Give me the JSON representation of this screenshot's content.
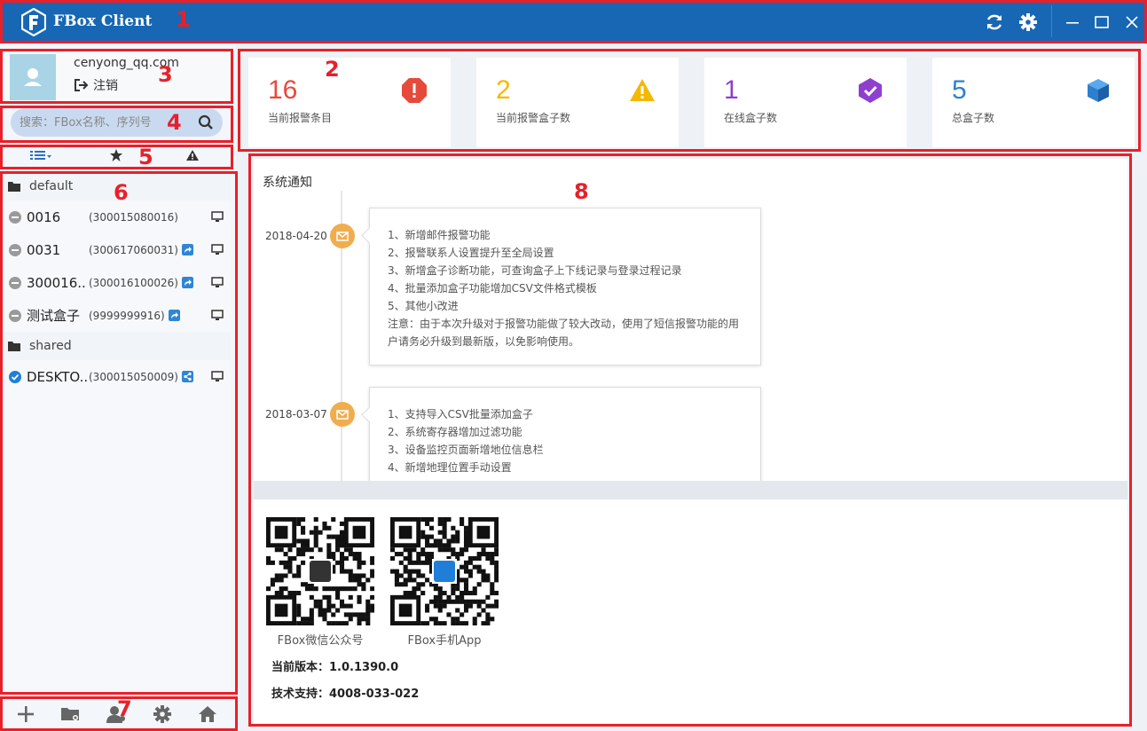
{
  "app": {
    "title": "FBox Client"
  },
  "user": {
    "email": "cenyong_qq.com",
    "logout_label": "注销"
  },
  "search": {
    "placeholder": "搜索：FBox名称、序列号"
  },
  "groups": [
    {
      "name": "default",
      "devices": [
        {
          "name": "0016",
          "serial": "(300015080016)",
          "status": "offline",
          "shared": false
        },
        {
          "name": "0031",
          "serial": "(300617060031)",
          "status": "offline",
          "shared": true
        },
        {
          "name": "300016..",
          "serial": "(300016100026)",
          "status": "offline",
          "shared": true
        },
        {
          "name": "测试盒子",
          "serial": "(9999999916)",
          "status": "offline",
          "shared": true
        }
      ]
    },
    {
      "name": "shared",
      "devices": [
        {
          "name": "DESKTO..",
          "serial": "(300015050009)",
          "status": "online",
          "shared": true
        }
      ]
    }
  ],
  "stats": [
    {
      "value": "16",
      "label": "当前报警条目",
      "color": "#e64a3b",
      "icon": "alarm-exclamation-icon"
    },
    {
      "value": "2",
      "label": "当前报警盒子数",
      "color": "#f5b800",
      "icon": "warning-triangle-icon"
    },
    {
      "value": "1",
      "label": "在线盒子数",
      "color": "#8e3fcf",
      "icon": "online-check-icon"
    },
    {
      "value": "5",
      "label": "总盒子数",
      "color": "#2d7fcf",
      "icon": "cube-icon"
    }
  ],
  "notice": {
    "title": "系统通知",
    "entries": [
      {
        "date": "2018-04-20",
        "lines": [
          "1、新增邮件报警功能",
          "2、报警联系人设置提升至全局设置",
          "3、新增盒子诊断功能，可查询盒子上下线记录与登录过程记录",
          "4、批量添加盒子功能增加CSV文件格式模板",
          "5、其他小改进",
          "注意：由于本次升级对于报警功能做了较大改动，使用了短信报警功能的用户请务必升级到最新版，以免影响使用。"
        ]
      },
      {
        "date": "2018-03-07",
        "lines": [
          "1、支持导入CSV批量添加盒子",
          "2、系统寄存器增加过滤功能",
          "3、设备监控页面新增地位信息栏",
          "4、新增地理位置手动设置"
        ]
      }
    ]
  },
  "footer": {
    "qr_wechat_label": "FBox微信公众号",
    "qr_app_label": "FBox手机App",
    "version_label": "当前版本：",
    "version_value": "1.0.1390.0",
    "support_label": "技术支持：",
    "support_value": "4008-033-022"
  },
  "annotations": [
    "1",
    "2",
    "3",
    "4",
    "5",
    "6",
    "7",
    "8"
  ],
  "colors": {
    "titlebar": "#1767b4",
    "accent_red": "#e8202a",
    "share_blue": "#2f86d4",
    "online_blue": "#1f7fd8"
  }
}
